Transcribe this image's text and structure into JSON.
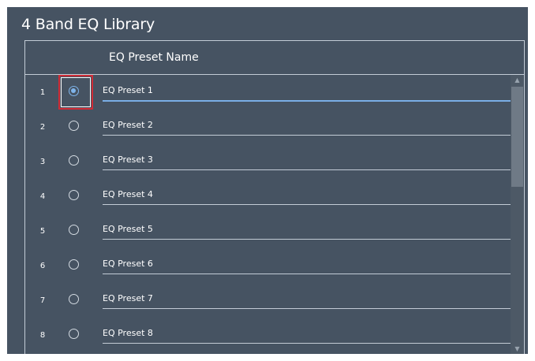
{
  "title": "4 Band EQ Library",
  "table": {
    "header": "EQ Preset Name",
    "selected_row": 1,
    "rows": [
      {
        "index": "1",
        "name": "EQ Preset 1"
      },
      {
        "index": "2",
        "name": "EQ Preset 2"
      },
      {
        "index": "3",
        "name": "EQ Preset 3"
      },
      {
        "index": "4",
        "name": "EQ Preset 4"
      },
      {
        "index": "5",
        "name": "EQ Preset 5"
      },
      {
        "index": "6",
        "name": "EQ Preset 6"
      },
      {
        "index": "7",
        "name": "EQ Preset 7"
      },
      {
        "index": "8",
        "name": "EQ Preset 8"
      }
    ]
  },
  "scrollbar": {
    "up_icon": "scroll-up-arrow",
    "down_icon": "scroll-down-arrow"
  },
  "colors": {
    "background": "#465362",
    "accent": "#7fb4ea",
    "highlight": "#cf2c36"
  }
}
